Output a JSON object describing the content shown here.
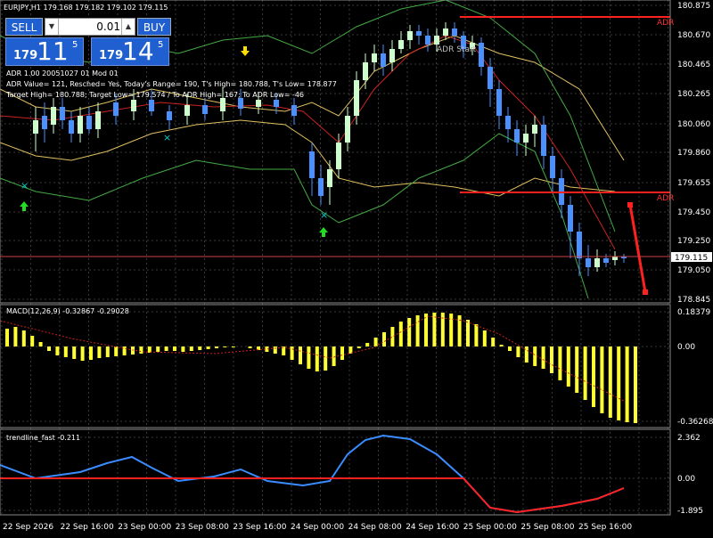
{
  "header": {
    "symbol_line": "EURJPY,H1  179.168 179.182 179.102 179.115"
  },
  "trade_panel": {
    "sell_label": "SELL",
    "buy_label": "BUY",
    "lot_value": "0.01",
    "sell_price": {
      "small": "179",
      "big": "11",
      "sup": "5"
    },
    "buy_price": {
      "small": "179",
      "big": "14",
      "sup": "5"
    }
  },
  "adr_info": {
    "line1": "ADR 1.00 20051027 01 Mod 01",
    "line2": "ADR Value= 121, Resched= Yes, Today's Range= 190, T's High= 180.788, T's Low= 178.877",
    "line3": "Target High= 180.788; Target Low= 179.574 / To ADR High= 167; To ADR Low= -46"
  },
  "annotations": {
    "adr_start": "ADR Start",
    "adr_tag_top": "ADR",
    "adr_tag_mid": "ADR"
  },
  "price_axis": {
    "labels": [
      "180.875",
      "180.670",
      "180.465",
      "180.265",
      "180.060",
      "179.860",
      "179.655",
      "179.450",
      "179.250",
      "179.050",
      "178.845"
    ],
    "current_price": "179.115"
  },
  "macd": {
    "title": "MACD(12,26,9) -0.32867 -0.29028",
    "axis_labels": [
      "0.18379",
      "0.00",
      "-0.36268"
    ]
  },
  "trendline": {
    "title": "trendline_fast -0.211",
    "axis_labels": [
      "2.362",
      "0.00",
      "-1.895"
    ]
  },
  "time_axis": {
    "labels": [
      "22 Sep 2026",
      "22 Sep 16:00",
      "23 Sep 00:00",
      "23 Sep 08:00",
      "23 Sep 16:00",
      "24 Sep 00:00",
      "24 Sep 08:00",
      "24 Sep 16:00",
      "25 Sep 00:00",
      "25 Sep 08:00",
      "25 Sep 16:00"
    ]
  },
  "colors": {
    "background": "#000000",
    "grid": "#3a3a3a",
    "bull_candle": "#ccffcc",
    "bear_candle": "#4a90ff",
    "macd_hist": "#ffff33",
    "signal": "#cc2222",
    "band_outer": "#44aa44",
    "band_yellow": "#e0c060",
    "adr_line": "#ff2020",
    "trend_blue": "#3a8cff",
    "trend_red": "#ff2020"
  }
}
